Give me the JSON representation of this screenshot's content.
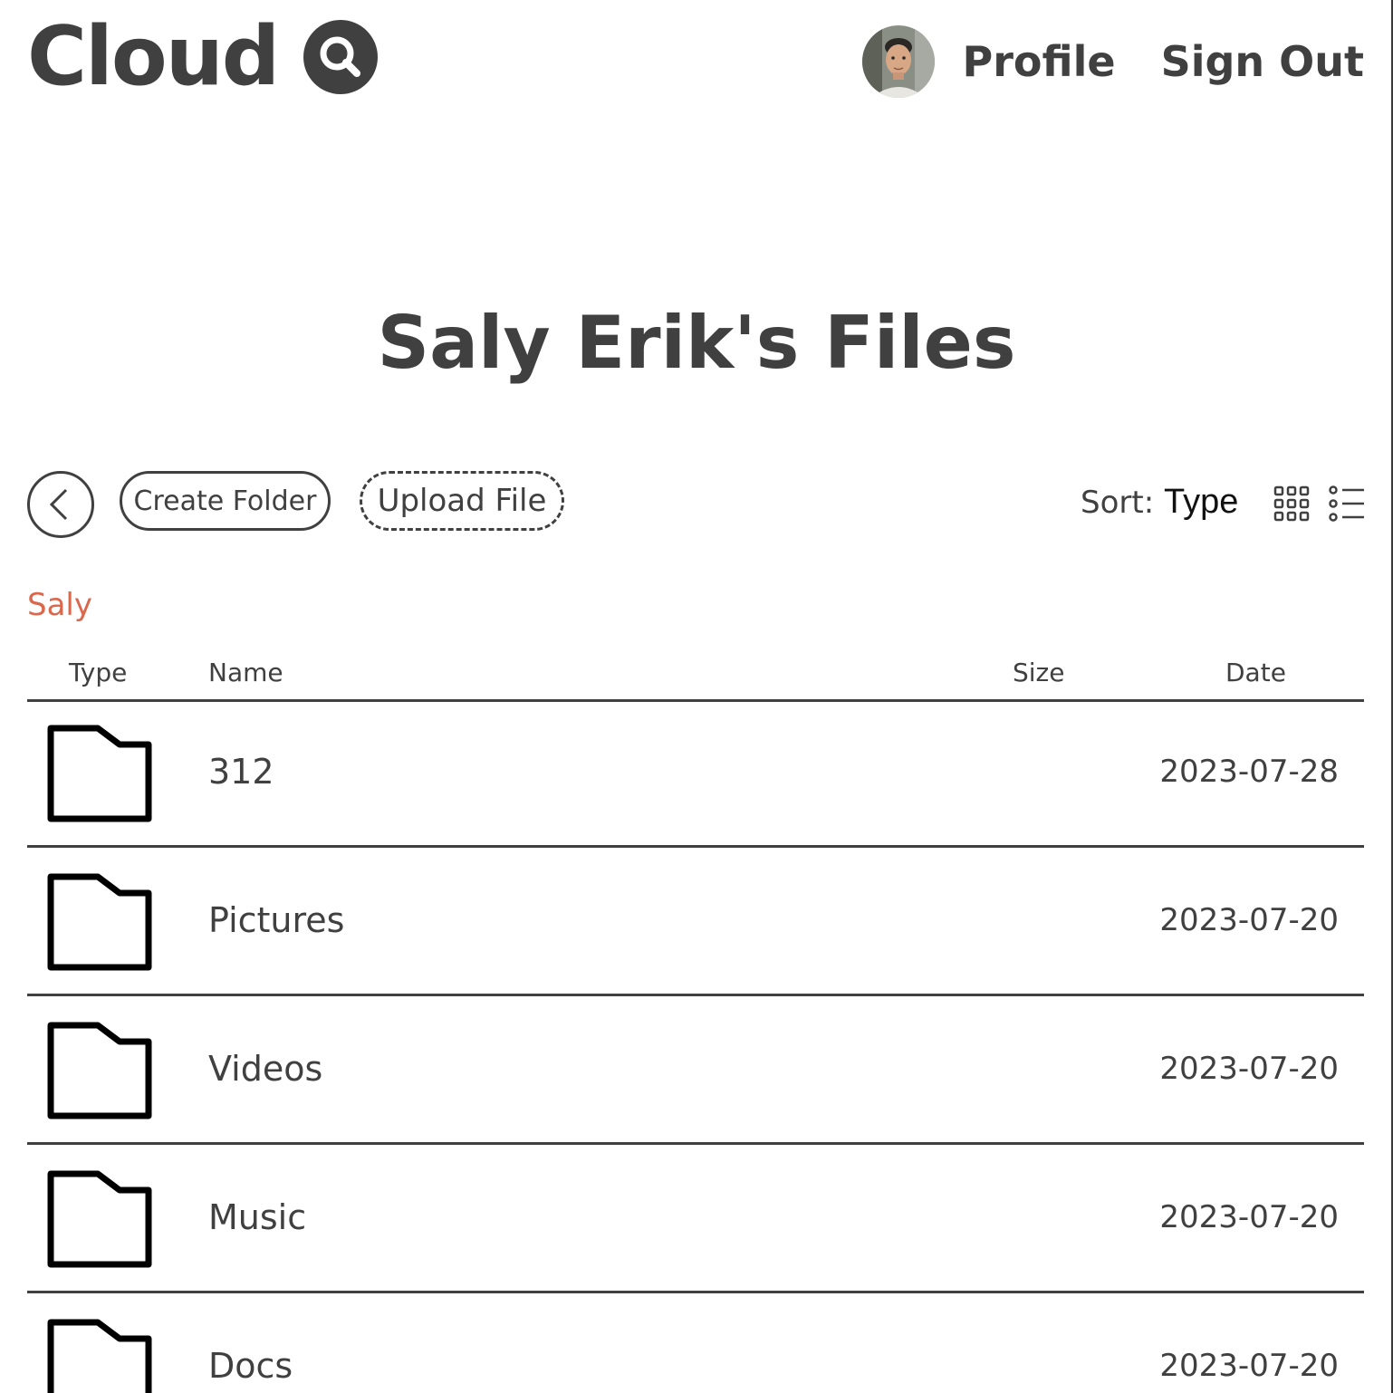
{
  "header": {
    "logo_text": "Cloud",
    "nav": {
      "profile_label": "Profile",
      "signout_label": "Sign Out"
    }
  },
  "title": "Saly Erik's Files",
  "toolbar": {
    "create_folder_label": "Create Folder",
    "upload_file_label": "Upload File",
    "sort_label": "Sort:",
    "sort_value": "Type"
  },
  "breadcrumb": "Saly",
  "table": {
    "headers": {
      "type": "Type",
      "name": "Name",
      "size": "Size",
      "date": "Date"
    },
    "rows": [
      {
        "type": "folder",
        "name": "312",
        "size": "",
        "date": "2023-07-28"
      },
      {
        "type": "folder",
        "name": "Pictures",
        "size": "",
        "date": "2023-07-20"
      },
      {
        "type": "folder",
        "name": "Videos",
        "size": "",
        "date": "2023-07-20"
      },
      {
        "type": "folder",
        "name": "Music",
        "size": "",
        "date": "2023-07-20"
      },
      {
        "type": "folder",
        "name": "Docs",
        "size": "",
        "date": "2023-07-20"
      }
    ]
  },
  "icons": {
    "logo": "search-icon",
    "back": "chevron-left-icon",
    "grid_view": "grid-view-icon",
    "list_view": "list-view-icon",
    "row_type": "folder-icon"
  },
  "colors": {
    "text": "#404040",
    "breadcrumb": "#d9684d",
    "background": "#ffffff"
  }
}
